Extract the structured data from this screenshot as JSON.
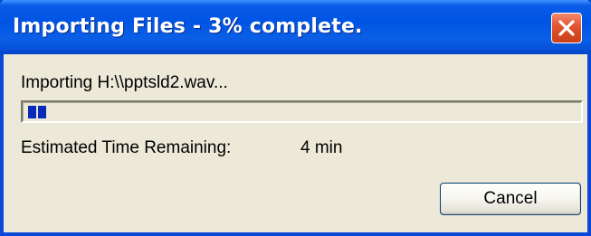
{
  "window": {
    "title": "Importing Files - 3% complete.",
    "close_icon": "close-x-icon",
    "titlebar_color": "#0054e3",
    "close_color": "#e0532e"
  },
  "progress": {
    "status_text": "Importing H:\\\\pptsld2.wav...",
    "percent": 3,
    "fill_color": "#0a2ab8"
  },
  "eta": {
    "label": "Estimated Time Remaining:",
    "value": "4 min"
  },
  "buttons": {
    "cancel_label": "Cancel"
  }
}
